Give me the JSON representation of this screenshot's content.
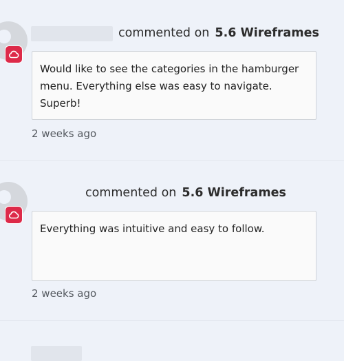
{
  "comments": [
    {
      "author": "",
      "action": "commented on",
      "target": "5.6 Wireframes",
      "body": "Would like to see the categories in the hamburger menu. Everything else was easy to navigate. Superb!",
      "time": "2 weeks ago",
      "badge_icon": "creative-cloud-icon",
      "badge_color": "#dd2a49"
    },
    {
      "author": "",
      "action": "commented on",
      "target": "5.6 Wireframes",
      "body": "Everything was intuitive and easy to follow.",
      "time": "2 weeks ago",
      "badge_icon": "creative-cloud-icon",
      "badge_color": "#dd2a49"
    }
  ]
}
